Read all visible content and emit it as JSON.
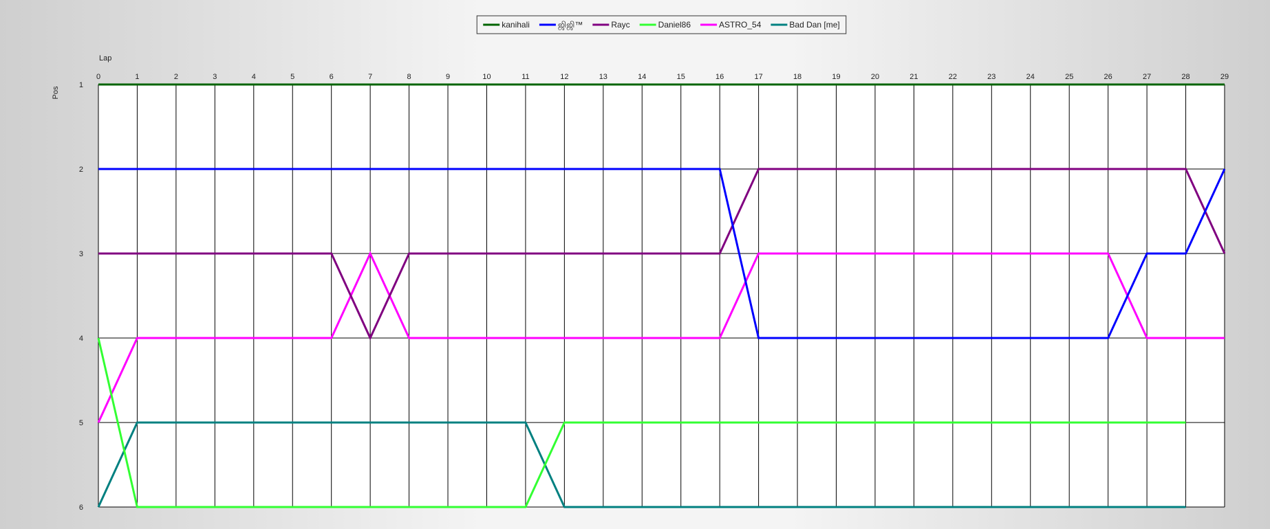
{
  "chart_data": {
    "type": "line",
    "title": "",
    "xlabel": "Lap",
    "ylabel": "Pos",
    "x": [
      0,
      1,
      2,
      3,
      4,
      5,
      6,
      7,
      8,
      9,
      10,
      11,
      12,
      13,
      14,
      15,
      16,
      17,
      18,
      19,
      20,
      21,
      22,
      23,
      24,
      25,
      26,
      27,
      28,
      29
    ],
    "xlim": [
      0,
      29
    ],
    "ylim": [
      1,
      6
    ],
    "y_inverted": true,
    "y_ticks": [
      1,
      2,
      3,
      4,
      5,
      6
    ],
    "grid": true,
    "legend_position": "top-center",
    "series": [
      {
        "name": "kanihali",
        "color": "#006400",
        "values": [
          1,
          1,
          1,
          1,
          1,
          1,
          1,
          1,
          1,
          1,
          1,
          1,
          1,
          1,
          1,
          1,
          1,
          1,
          1,
          1,
          1,
          1,
          1,
          1,
          1,
          1,
          1,
          1,
          1,
          1
        ]
      },
      {
        "name": "ஜிஜி™",
        "color": "#0000ff",
        "values": [
          2,
          2,
          2,
          2,
          2,
          2,
          2,
          2,
          2,
          2,
          2,
          2,
          2,
          2,
          2,
          2,
          2,
          4,
          4,
          4,
          4,
          4,
          4,
          4,
          4,
          4,
          4,
          3,
          3,
          2
        ]
      },
      {
        "name": "Rayc",
        "color": "#800080",
        "values": [
          3,
          3,
          3,
          3,
          3,
          3,
          3,
          4,
          3,
          3,
          3,
          3,
          3,
          3,
          3,
          3,
          3,
          2,
          2,
          2,
          2,
          2,
          2,
          2,
          2,
          2,
          2,
          2,
          2,
          3
        ]
      },
      {
        "name": "Daniel86",
        "color": "#32ff32",
        "values": [
          4,
          6,
          6,
          6,
          6,
          6,
          6,
          6,
          6,
          6,
          6,
          6,
          5,
          5,
          5,
          5,
          5,
          5,
          5,
          5,
          5,
          5,
          5,
          5,
          5,
          5,
          5,
          5,
          5,
          null
        ]
      },
      {
        "name": "ASTRO_54",
        "color": "#ff00ff",
        "values": [
          5,
          4,
          4,
          4,
          4,
          4,
          4,
          3,
          4,
          4,
          4,
          4,
          4,
          4,
          4,
          4,
          4,
          3,
          3,
          3,
          3,
          3,
          3,
          3,
          3,
          3,
          3,
          4,
          4,
          4
        ]
      },
      {
        "name": "Bad Dan [me]",
        "color": "#008080",
        "values": [
          6,
          5,
          5,
          5,
          5,
          5,
          5,
          5,
          5,
          5,
          5,
          5,
          6,
          6,
          6,
          6,
          6,
          6,
          6,
          6,
          6,
          6,
          6,
          6,
          6,
          6,
          6,
          6,
          6,
          null
        ]
      }
    ]
  }
}
